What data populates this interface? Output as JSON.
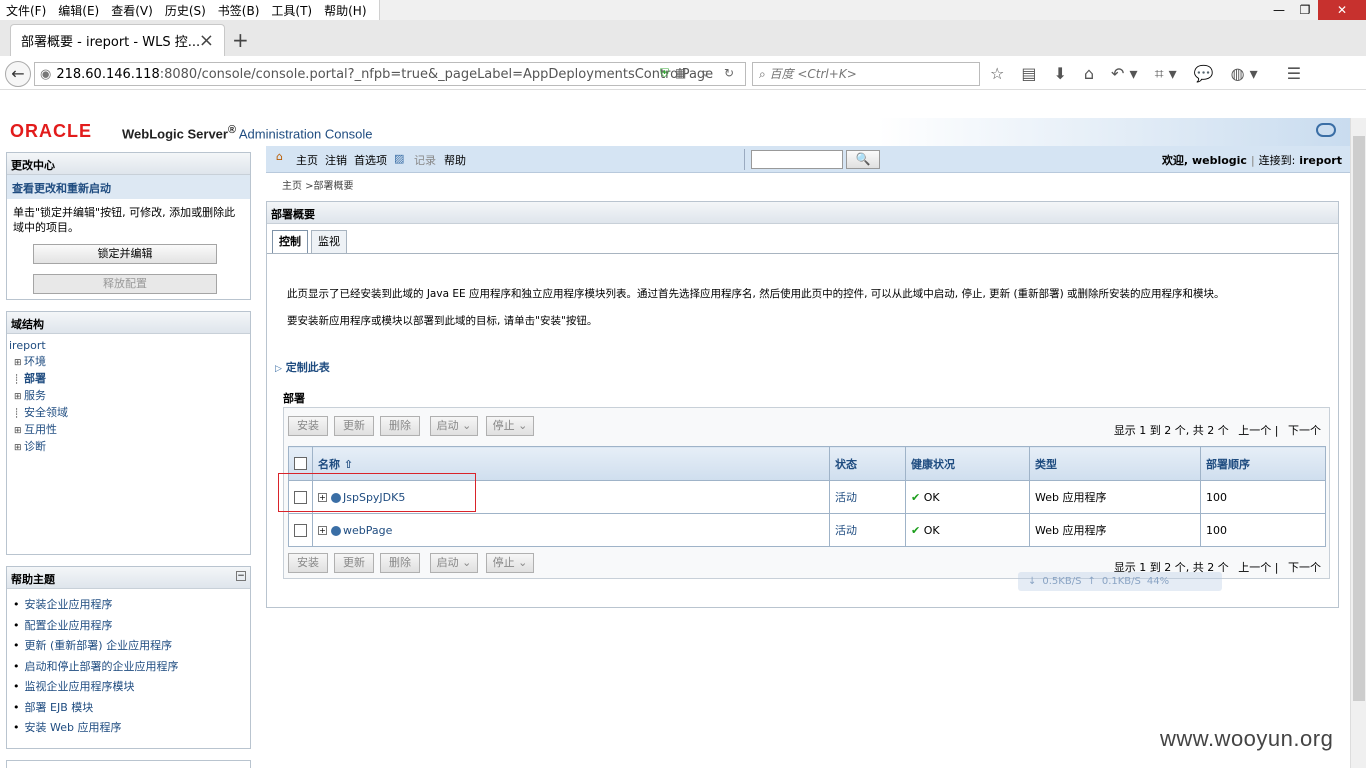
{
  "browser": {
    "menu": [
      "文件(F)",
      "编辑(E)",
      "查看(V)",
      "历史(S)",
      "书签(B)",
      "工具(T)",
      "帮助(H)"
    ],
    "tab_title": "部署概要 - ireport - WLS 控...",
    "url_host": "218.60.146.118",
    "url_rest": ":8080/console/console.portal?_nfpb=true&_pageLabel=AppDeploymentsControlPage",
    "search_placeholder": "百度 <Ctrl+K>"
  },
  "header": {
    "oracle": "ORACLE",
    "product": "WebLogic Server",
    "reg": "®",
    "admin": " Administration Console"
  },
  "change_center": {
    "title": "更改中心",
    "link": "查看更改和重新启动",
    "desc": "单击\"锁定并编辑\"按钮, 可修改, 添加或删除此域中的项目。",
    "lock_button": "锁定并编辑",
    "release_button": "释放配置"
  },
  "domain_tree": {
    "title": "域结构",
    "root": "ireport",
    "nodes": [
      {
        "label": "环境",
        "expand": "⊞"
      },
      {
        "label": "部署",
        "expand": "┊"
      },
      {
        "label": "服务",
        "expand": "⊞"
      },
      {
        "label": "安全领域",
        "expand": "┊"
      },
      {
        "label": "互用性",
        "expand": "⊞"
      },
      {
        "label": "诊断",
        "expand": "⊞"
      }
    ]
  },
  "help_topics": {
    "title": "帮助主题",
    "collapse": "−",
    "items": [
      "安装企业应用程序",
      "配置企业应用程序",
      "更新 (重新部署) 企业应用程序",
      "启动和停止部署的企业应用程序",
      "监视企业应用程序模块",
      "部署 EJB 模块",
      "安装 Web 应用程序"
    ]
  },
  "toolbar": {
    "home": "主页",
    "logout": "注销",
    "preferences": "首选项",
    "record": "记录",
    "help": "帮助",
    "welcome": "欢迎, weblogic",
    "connected": "连接到: ireport"
  },
  "breadcrumb": "主页 >部署概要",
  "main": {
    "title": "部署概要",
    "tabs": [
      "控制",
      "监视"
    ],
    "desc1": "此页显示了已经安装到此域的 Java EE 应用程序和独立应用程序模块列表。通过首先选择应用程序名, 然后使用此页中的控件, 可以从此域中启动, 停止, 更新 (重新部署) 或删除所安装的应用程序和模块。",
    "desc2": "要安装新应用程序或模块以部署到此域的目标, 请单击\"安装\"按钮。",
    "customize": "定制此表",
    "section_title": "部署",
    "buttons": {
      "install": "安装",
      "update": "更新",
      "delete": "删除",
      "start": "启动 ⌄",
      "stop": "停止 ⌄"
    },
    "pager": {
      "summary": "显示 1 到 2 个, 共 2 个",
      "prev": "上一个",
      "sep": "|",
      "next": "下一个"
    },
    "columns": {
      "name": "名称",
      "sort": "⇧",
      "state": "状态",
      "health": "健康状况",
      "type": "类型",
      "order": "部署顺序"
    },
    "rows": [
      {
        "name": "JspSpyJDK5",
        "state": "活动",
        "health": "OK",
        "type": "Web 应用程序",
        "order": "100"
      },
      {
        "name": "webPage",
        "state": "活动",
        "health": "OK",
        "type": "Web 应用程序",
        "order": "100"
      }
    ]
  },
  "speed": {
    "down": "0.5KB/S",
    "up": "0.1KB/S",
    "pct": "44%"
  },
  "watermark": "www.wooyun.org"
}
